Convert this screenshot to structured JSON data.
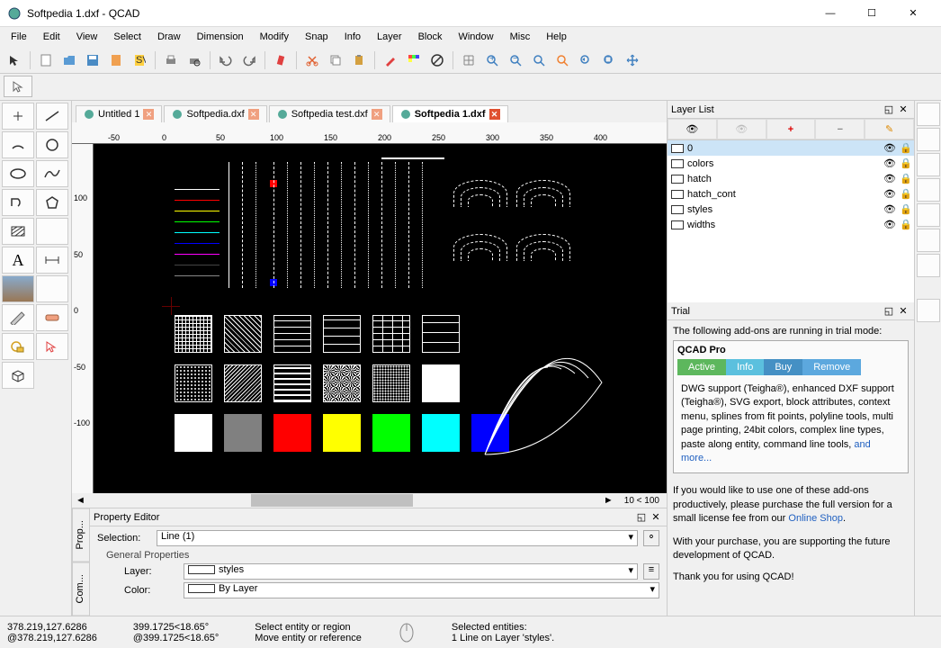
{
  "window": {
    "title": "Softpedia 1.dxf - QCAD",
    "min": "—",
    "max": "☐",
    "close": "✕"
  },
  "menu": [
    "File",
    "Edit",
    "View",
    "Select",
    "Draw",
    "Dimension",
    "Modify",
    "Snap",
    "Info",
    "Layer",
    "Block",
    "Window",
    "Misc",
    "Help"
  ],
  "tabs": [
    {
      "label": "Untitled 1",
      "active": false
    },
    {
      "label": "Softpedia.dxf",
      "active": false
    },
    {
      "label": "Softpedia test.dxf",
      "active": false
    },
    {
      "label": "Softpedia 1.dxf",
      "active": true
    }
  ],
  "ruler_h": [
    "-50",
    "0",
    "50",
    "100",
    "150",
    "200",
    "250",
    "300",
    "350",
    "400"
  ],
  "ruler_v": [
    "100",
    "50",
    "0",
    "-50",
    "-100"
  ],
  "zoom_indicator": "10 < 100",
  "layer_panel": {
    "title": "Layer List",
    "layers": [
      {
        "name": "0",
        "selected": true
      },
      {
        "name": "colors",
        "selected": false
      },
      {
        "name": "hatch",
        "selected": false
      },
      {
        "name": "hatch_cont",
        "selected": false
      },
      {
        "name": "styles",
        "selected": false
      },
      {
        "name": "widths",
        "selected": false
      }
    ]
  },
  "trial": {
    "title": "Trial",
    "intro": "The following add-ons are running in trial mode:",
    "product": "QCAD Pro",
    "tabs": {
      "active": "Active",
      "info": "Info",
      "buy": "Buy",
      "remove": "Remove"
    },
    "desc": "DWG support (Teigha®), enhanced DXF support (Teigha®), SVG export, block attributes, context menu, splines from fit points, polyline tools, multi page printing, 24bit colors, complex line types, paste along entity, command line tools, ",
    "more": "and more...",
    "msg1": "If you would like to use one of these add-ons productively, please purchase the full version for a small license fee from our ",
    "shop": "Online Shop",
    "msg2": "With your purchase, you are supporting the future development of QCAD.",
    "thanks": "Thank you for using QCAD!"
  },
  "prop": {
    "title": "Property Editor",
    "selection_label": "Selection:",
    "selection_value": "Line (1)",
    "group": "General Properties",
    "layer_label": "Layer:",
    "layer_value": "styles",
    "color_label": "Color:",
    "color_value": "By Layer",
    "vtab1": "Prop...",
    "vtab2": "Com..."
  },
  "status": {
    "abs": "378.219,127.6286",
    "rel": "@378.219,127.6286",
    "polar_abs": "399.1725<18.65°",
    "polar_rel": "@399.1725<18.65°",
    "hint1": "Select entity or region",
    "hint2": "Move entity or reference",
    "sel_label": "Selected entities:",
    "sel_value": "1 Line on Layer 'styles'."
  },
  "colors": {
    "white": "#ffffff",
    "red": "#ff0000",
    "yellow": "#ffff00",
    "green": "#00ff00",
    "cyan": "#00ffff",
    "blue": "#0000ff"
  }
}
